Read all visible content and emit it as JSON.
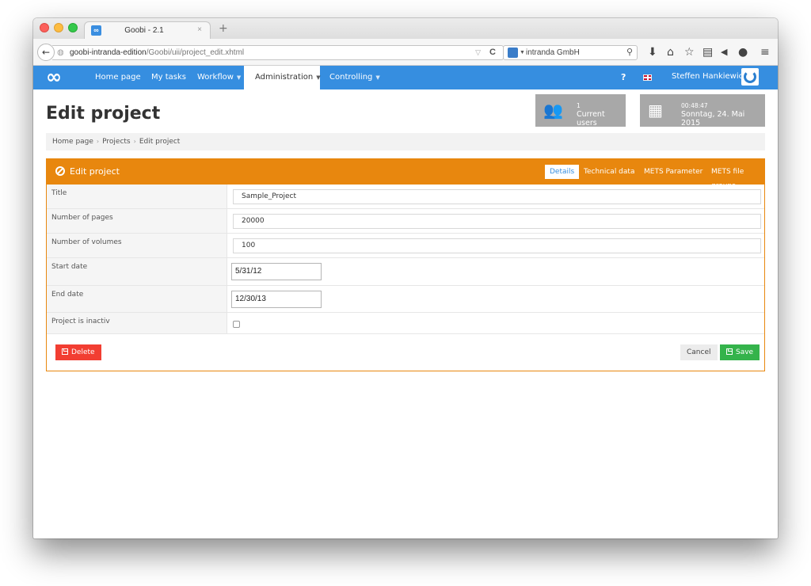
{
  "browser": {
    "tab_title": "Goobi - 2.1",
    "tab_close": "×",
    "new_tab": "+",
    "url_host": "goobi-intranda-edition",
    "url_path": "/Goobi/uii/project_edit.xhtml",
    "search_text": "intranda GmbH",
    "icons": {
      "back": "←",
      "reload": "C",
      "dropdown": "▽",
      "search": "🔍",
      "download": "⬇",
      "home": "⌂",
      "bookmark": "☆",
      "reader": "▤",
      "pocket": "◀",
      "chat": "●",
      "menu": "≡"
    }
  },
  "app": {
    "logo": "∞",
    "nav": [
      {
        "label": "Home page"
      },
      {
        "label": "My tasks"
      },
      {
        "label": "Workflow",
        "has_menu": true
      },
      {
        "label": "Administration",
        "has_menu": true,
        "active": true
      },
      {
        "label": "Controlling",
        "has_menu": true
      }
    ],
    "caret": "▼",
    "help": "?",
    "language": "en",
    "user_name": "Steffen Hankiewicz",
    "colors": {
      "header": "#368ee0",
      "panel": "#e8870e",
      "delete": "#f23e32",
      "save": "#34b34b"
    }
  },
  "page": {
    "title": "Edit project",
    "breadcrumb": [
      "Home page",
      "Projects",
      "Edit project"
    ],
    "breadcrumb_sep": "›",
    "stats": {
      "users_count": "1",
      "users_label": "Current users",
      "time": "00:48:47",
      "date": "Sonntag, 24. Mai 2015"
    }
  },
  "panel": {
    "title": "Edit project",
    "tabs": [
      {
        "label": "Details",
        "active": true
      },
      {
        "label": "Technical data"
      },
      {
        "label": "METS Parameter"
      },
      {
        "label": "METS file groups"
      }
    ],
    "fields": [
      {
        "label": "Title",
        "value": "Sample_Project"
      },
      {
        "label": "Number of pages",
        "value": "20000"
      },
      {
        "label": "Number of volumes",
        "value": "100"
      },
      {
        "label": "Start date",
        "value": "5/31/12"
      },
      {
        "label": "End date",
        "value": "12/30/13"
      },
      {
        "label": "Project is inactiv",
        "checked": false
      }
    ],
    "buttons": {
      "delete": "Delete",
      "cancel": "Cancel",
      "save": "Save"
    }
  }
}
